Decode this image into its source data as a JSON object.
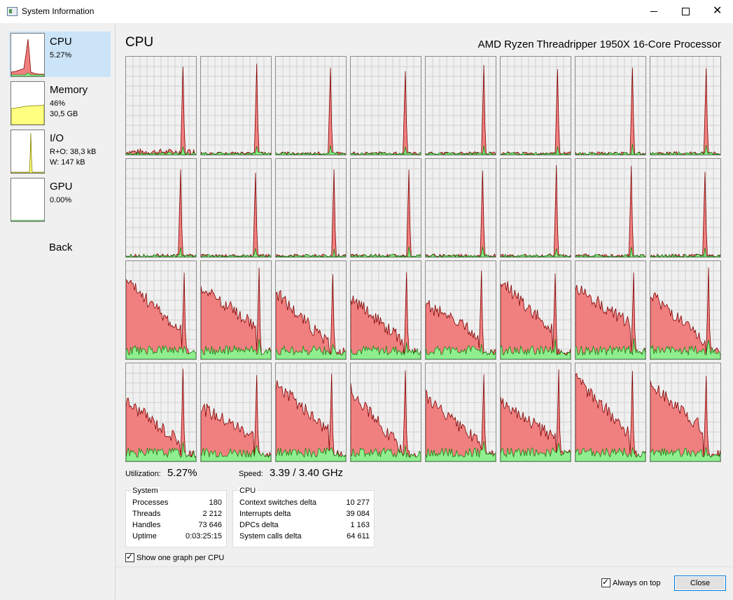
{
  "window": {
    "title": "System Information"
  },
  "sidebar": {
    "items": [
      {
        "title": "CPU",
        "lines": [
          "5.27%"
        ]
      },
      {
        "title": "Memory",
        "lines": [
          "46%",
          "30,5 GB"
        ]
      },
      {
        "title": "I/O",
        "lines": [
          "R+O: 38,3 kB",
          "W: 147 kB"
        ]
      },
      {
        "title": "GPU",
        "lines": [
          "0.00%"
        ]
      }
    ],
    "back_label": "Back"
  },
  "main": {
    "title": "CPU",
    "processor": "AMD Ryzen Threadripper 1950X 16-Core Processor",
    "utilization_label": "Utilization:",
    "utilization_value": "5.27%",
    "speed_label": "Speed:",
    "speed_value": "3.39 / 3.40 GHz"
  },
  "system_group": {
    "title": "System",
    "rows": [
      {
        "label": "Processes",
        "value": "180"
      },
      {
        "label": "Threads",
        "value": "2 212"
      },
      {
        "label": "Handles",
        "value": "73 646"
      },
      {
        "label": "Uptime",
        "value": "0:03:25:15"
      }
    ]
  },
  "cpu_group": {
    "title": "CPU",
    "rows": [
      {
        "label": "Context switches delta",
        "value": "10 277"
      },
      {
        "label": "Interrupts delta",
        "value": "39 084"
      },
      {
        "label": "DPCs delta",
        "value": "1 163"
      },
      {
        "label": "System calls delta",
        "value": "64 611"
      }
    ]
  },
  "options": {
    "one_graph_label": "Show one graph per CPU",
    "always_on_top_label": "Always on top",
    "close_label": "Close"
  },
  "colors": {
    "total_fill": "#f08080",
    "total_line": "#800000",
    "kernel_fill": "#90ee90",
    "kernel_line": "#008000",
    "memory_fill": "#ffff80",
    "grid": "#d0d0d0"
  },
  "chart_data": {
    "type": "area",
    "core_count": 32,
    "ylim": [
      0,
      100
    ],
    "series": [
      {
        "name": "Total",
        "color": "#f08080"
      },
      {
        "name": "Kernel",
        "color": "#90ee90"
      }
    ]
  }
}
